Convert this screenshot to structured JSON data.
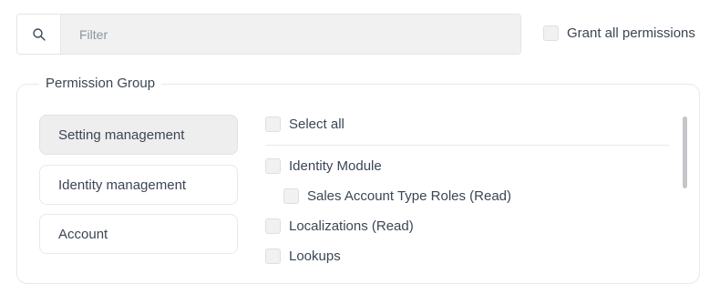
{
  "filter": {
    "placeholder": "Filter",
    "value": ""
  },
  "grant_all": {
    "label": "Grant all permissions",
    "checked": false
  },
  "group": {
    "legend": "Permission Group",
    "sidebar": [
      {
        "label": "Setting management",
        "active": true
      },
      {
        "label": "Identity management",
        "active": false
      },
      {
        "label": "Account",
        "active": false
      }
    ],
    "select_all": {
      "label": "Select all",
      "checked": false
    },
    "permissions": [
      {
        "label": "Identity Module",
        "level": 0,
        "checked": false
      },
      {
        "label": "Sales Account Type Roles (Read)",
        "level": 1,
        "checked": false
      },
      {
        "label": "Localizations (Read)",
        "level": 0,
        "checked": false
      },
      {
        "label": "Lookups",
        "level": 0,
        "checked": false
      }
    ]
  },
  "icons": {
    "filter": "search-icon"
  },
  "colors": {
    "active_tab_bg": "#eeeeee",
    "border": "#e6e9ed",
    "text": "#3b4654"
  }
}
